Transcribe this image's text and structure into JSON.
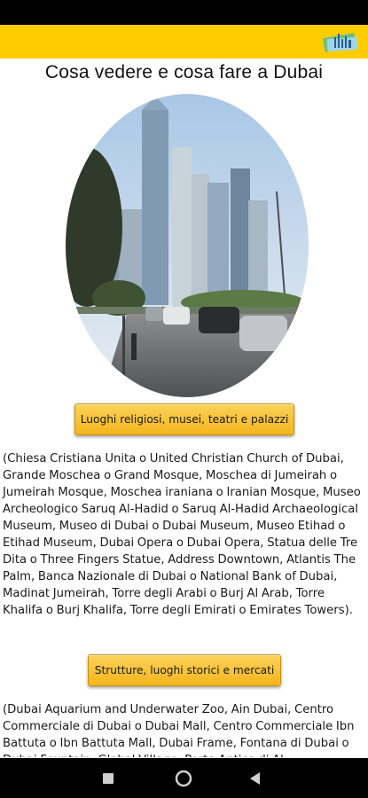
{
  "header": {
    "logo_icon": "dubai-skyline-logo-icon",
    "background": "#ffcc00"
  },
  "main": {
    "title": "Cosa vedere e cosa fare a Dubai",
    "photo_icon": "dubai-marina-photo",
    "sections": [
      {
        "button_label": "Luoghi religiosi, musei, teatri e palazzi",
        "text": "(Chiesa Cristiana Unita o United Christian Church of Dubai, Grande Moschea o Grand Mosque, Moschea di Jumeirah o Jumeirah Mosque, Moschea iraniana o Iranian Mosque, Museo Archeologico Saruq Al-Hadid o Saruq Al-Hadid Archaeological Museum, Museo di Dubai o Dubai Museum, Museo Etihad o Etihad Museum, Dubai Opera o Dubai Opera, Statua delle Tre Dita o Three Fingers Statue, Address Downtown, Atlantis The Palm, Banca Nazionale di Dubai o National Bank of Dubai, Madinat Jumeirah, Torre degli Arabi o Burj Al Arab, Torre Khalifa o Burj Khalifa, Torre degli Emirati o Emirates Towers)."
      },
      {
        "button_label": "Strutture, luoghi storici e mercati",
        "text": "(Dubai Aquarium and Underwater Zoo, Ain Dubai, Centro Commerciale di Dubai o Dubai Mall, Centro Commerciale Ibn Battuta o Ibn Battuta Mall, Dubai Frame, Fontana di Dubai o Dubai Fountain, Global Village, Porto Antico di Al"
      }
    ],
    "button_color": "#f5bc22"
  },
  "nav": {
    "recent_icon": "square-recents-icon",
    "home_icon": "circle-home-icon",
    "back_icon": "triangle-back-icon"
  }
}
